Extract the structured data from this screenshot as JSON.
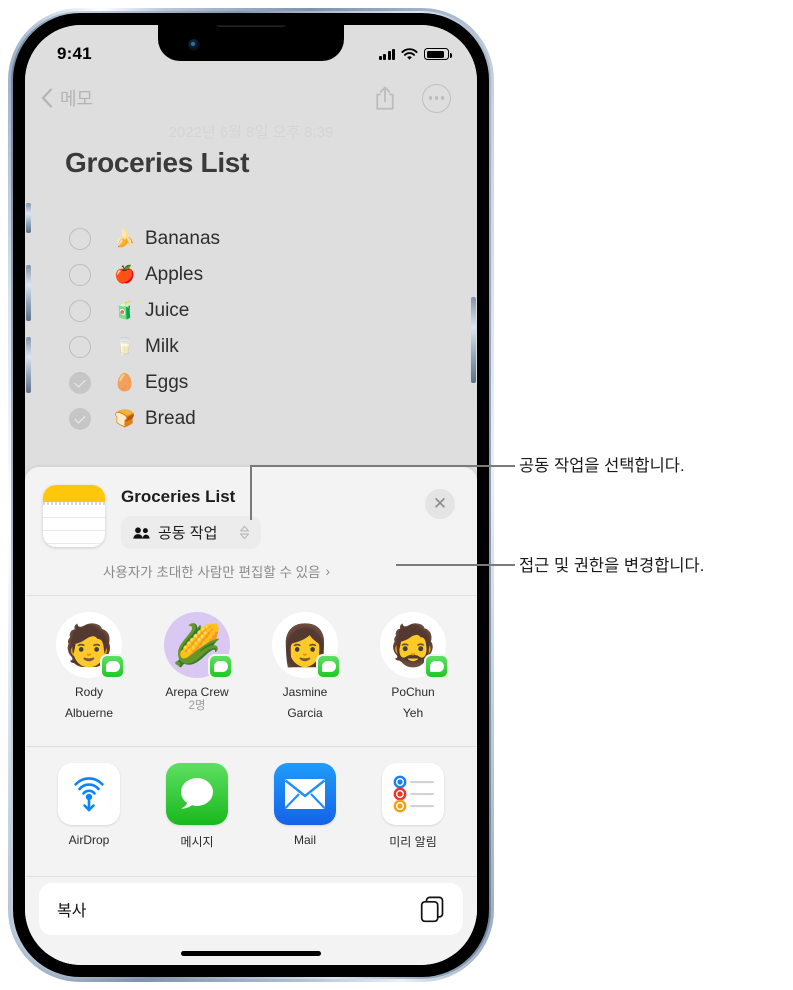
{
  "status_bar": {
    "time": "9:41",
    "signal_icon": "cellular-bars-icon",
    "wifi_icon": "wifi-icon",
    "battery_icon": "battery-icon"
  },
  "note": {
    "back_label": "메모",
    "share_icon": "share-icon",
    "more_icon": "more-circle-icon",
    "date": "2022년 6월 8일 오후 8:39",
    "title": "Groceries List",
    "items": [
      {
        "emoji": "🍌",
        "label": "Bananas",
        "checked": false
      },
      {
        "emoji": "🍎",
        "label": "Apples",
        "checked": false
      },
      {
        "emoji": "🧃",
        "label": "Juice",
        "checked": false
      },
      {
        "emoji": "🥛",
        "label": "Milk",
        "checked": false
      },
      {
        "emoji": "🥚",
        "label": "Eggs",
        "checked": true
      },
      {
        "emoji": "🍞",
        "label": "Bread",
        "checked": true
      }
    ]
  },
  "share_sheet": {
    "app_icon": "notes-app-icon",
    "title": "Groceries List",
    "mode_pill": {
      "icon": "two-people-icon",
      "label": "공동 작업",
      "chevron": "up-down-chevron-icon"
    },
    "permission": "사용자가 초대한 사람만 편집할 수 있음",
    "permission_chevron": "›",
    "close_icon": "close-icon",
    "contacts": [
      {
        "name_line1": "Rody",
        "name_line2": "Albuerne",
        "sub": "",
        "avatar": "🧑",
        "avatar_kind": "memoji-green-cap",
        "badge": "messages-badge-icon"
      },
      {
        "name_line1": "Arepa Crew",
        "name_line2": "",
        "sub": "2명",
        "avatar": "🌽",
        "avatar_kind": "corn-emoji-purple",
        "badge": "messages-badge-icon"
      },
      {
        "name_line1": "Jasmine",
        "name_line2": "Garcia",
        "sub": "",
        "avatar": "👩",
        "avatar_kind": "memoji-glasses",
        "badge": "messages-badge-icon"
      },
      {
        "name_line1": "PoChun",
        "name_line2": "Yeh",
        "sub": "",
        "avatar": "🧔",
        "avatar_kind": "memoji-beard",
        "badge": "messages-badge-icon"
      }
    ],
    "apps": [
      {
        "name": "AirDrop",
        "icon": "airdrop-icon"
      },
      {
        "name": "메시지",
        "icon": "messages-icon"
      },
      {
        "name": "Mail",
        "icon": "mail-icon"
      },
      {
        "name": "미리 알림",
        "icon": "reminders-icon"
      }
    ],
    "actions": [
      {
        "label": "복사",
        "icon": "copy-icon"
      }
    ]
  },
  "callouts": [
    {
      "text": "공동 작업을 선택합니다."
    },
    {
      "text": "접근 및 권한을 변경합니다."
    }
  ],
  "colors": {
    "note_bg": "#dedede",
    "sheet_bg": "#f3f3f3",
    "notes_yellow": "#ffc709",
    "messages_green": "#2fc42f",
    "mail_blue": "#1d8dfb",
    "airdrop_blue": "#007aff",
    "callout_line": "#7a7a7a"
  }
}
